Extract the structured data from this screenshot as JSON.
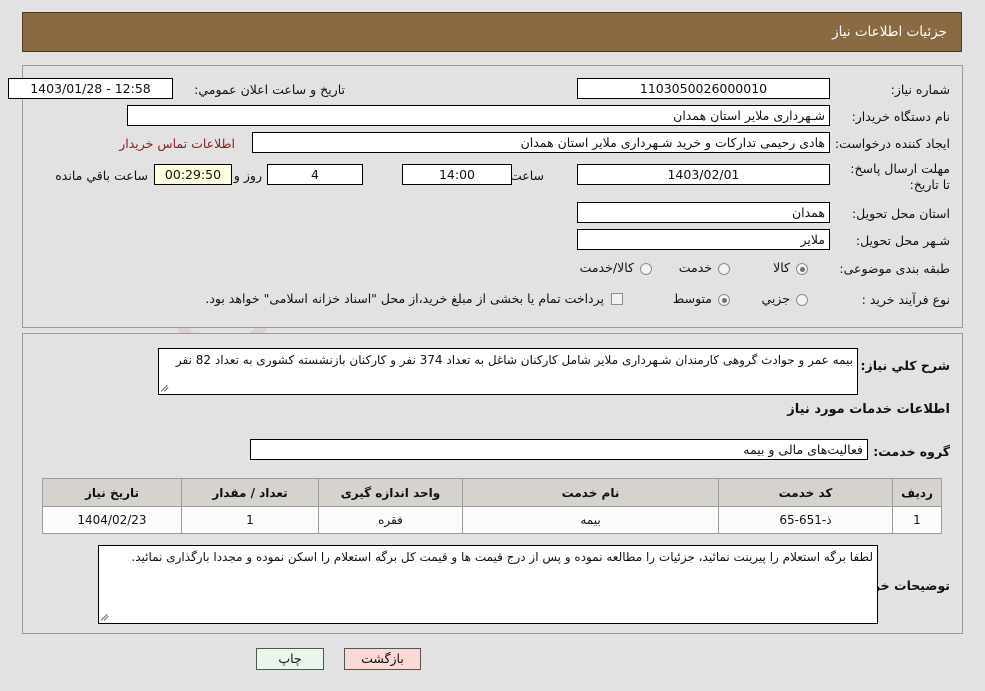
{
  "header": {
    "title": "جزئیات اطلاعات نیاز"
  },
  "colors": {
    "header_bg": "#8a6a43",
    "page_bg": "#e2e2e2",
    "field_bg": "#ffffff",
    "countdown_bg": "#ffffe0",
    "link": "#8b1a1a",
    "return_button_bg": "#fbd9d4",
    "print_button_bg": "#e9f7ea",
    "table_header_bg": "#d6d3cf"
  },
  "watermark": {
    "text": "ArtaTender.net"
  },
  "top_panel": {
    "right_column": [
      {
        "label": "شماره نیاز:",
        "value": "1103050026000010"
      },
      {
        "label": "نام دستگاه خریدار:",
        "value": "شـهرداری ملایر استان همدان"
      },
      {
        "label": "ایجاد کننده درخواست:",
        "value": "هادی رحیمی تدارکات و خرید شـهرداری ملایر استان همدان"
      },
      {
        "label": "مهلت ارسال پاسخ: تا تاریخ:",
        "value": "1403/02/01"
      },
      {
        "label": "استان محل تحویل:",
        "value": "همدان"
      },
      {
        "label": "شـهر محل تحویل:",
        "value": "ملایر"
      },
      {
        "label": "طبقه بندی موضوعی:",
        "value": ""
      },
      {
        "label": "نوع فرآیند خرید :",
        "value": ""
      }
    ],
    "announcement": {
      "label": "تاریخ و ساعت اعلان عمومي:",
      "value": "12:58 - 1403/01/28"
    },
    "contact_link": "اطلاعات تماس خریدار",
    "deadline": {
      "hour_label": "ساعت",
      "hour_value": "14:00",
      "days_value": "4",
      "days_label": "روز و",
      "countdown_value": "00:29:50",
      "countdown_label": "ساعت باقي مانده"
    },
    "category_radios": [
      {
        "label": "کالا",
        "checked": false
      },
      {
        "label": "خدمت",
        "checked": true
      },
      {
        "label": "کالا/خدمت",
        "checked": false
      }
    ],
    "process_radios": [
      {
        "label": "جزیي",
        "checked": false
      },
      {
        "label": "متوسط",
        "checked": true
      }
    ],
    "treasury_checkbox": {
      "label": "پرداخت تمام یا بخشی از مبلغ خرید،از محل \"اسناد خزانه اسلامی\" خواهد بود.",
      "checked": false
    }
  },
  "mid_panel": {
    "need_description": {
      "label": "شرح کلي نیاز:",
      "value": "بیمه عمر و حوادث گروهی کارمندان شـهرداری ملایر شامل کارکنان شاغل به تعداد 374 نفر و کارکنان بازنشسته کشوری به تعداد 82 نفر"
    },
    "services_section_title": "اطلاعات خدمات مورد نیاز",
    "service_group": {
      "label": "گروه خدمت:",
      "value": "فعالیت‌های مالی و بیمه"
    },
    "table": {
      "headers": [
        "ردیف",
        "کد خدمت",
        "نام خدمت",
        "واحد اندازه گیری",
        "تعداد / مقدار",
        "تاریخ نیاز"
      ],
      "rows": [
        [
          "1",
          "ذ-651-65",
          "بیمه",
          "فقره",
          "1",
          "1404/02/23"
        ]
      ]
    },
    "buyer_notes": {
      "label": "توضیحات خریدار:",
      "value": "لطفا برگه استعلام را پیرینت نمائید، جزئیات را مطالعه نموده و پس از درج قیمت ها و قیمت کل برگه استعلام را اسکن نموده و مجددا بارگذاری نمائید."
    }
  },
  "footer": {
    "print_label": "چاپ",
    "return_label": "بازگشت"
  }
}
